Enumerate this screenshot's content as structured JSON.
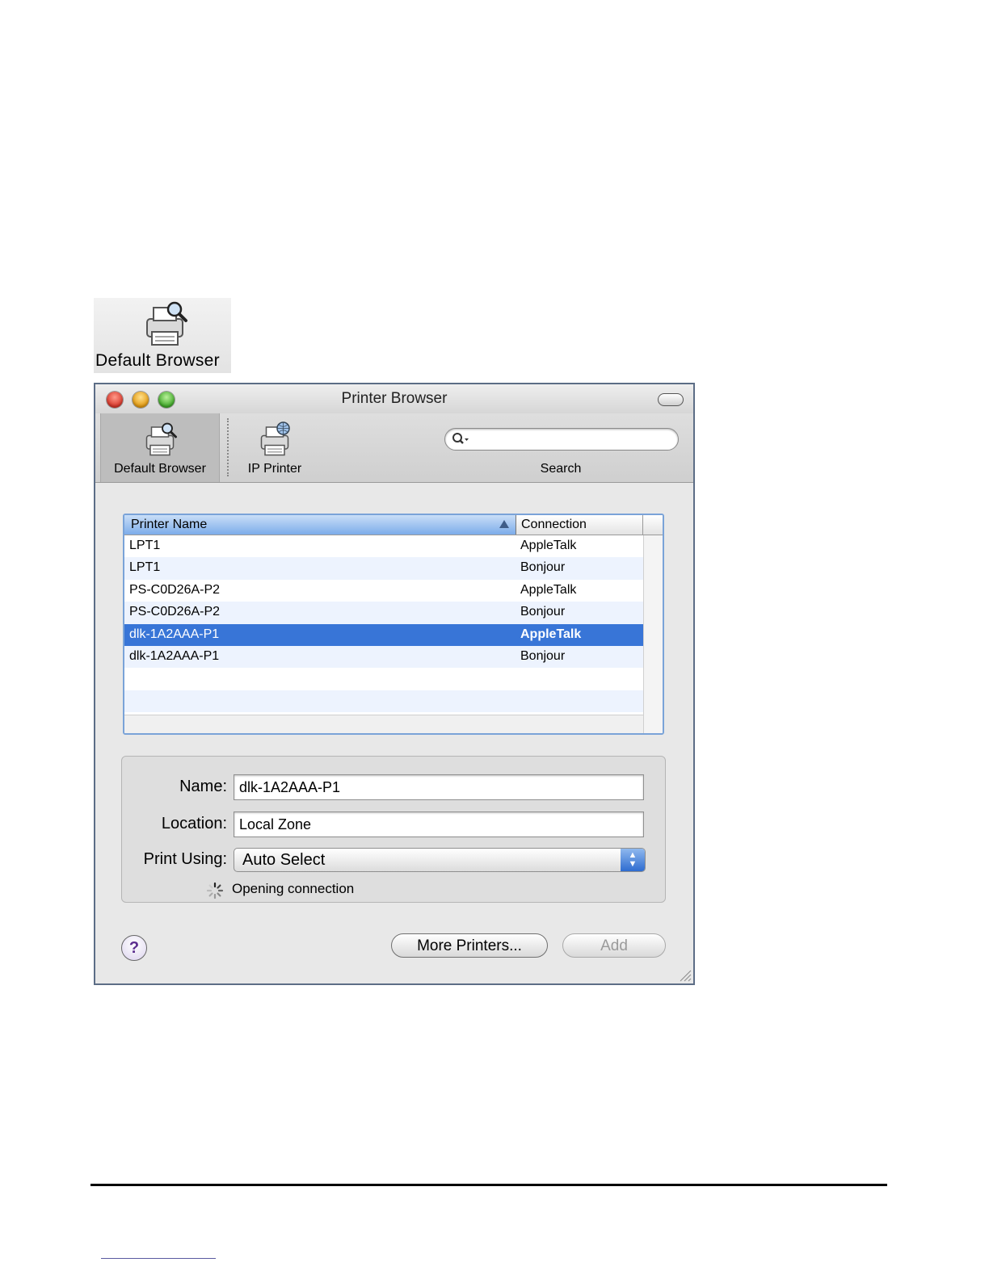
{
  "snippet": {
    "label": "Default Browser"
  },
  "window": {
    "title": "Printer Browser",
    "toolbar": {
      "default_browser_label": "Default Browser",
      "ip_printer_label": "IP Printer",
      "search_label": "Search",
      "search_value": ""
    },
    "table": {
      "columns": [
        "Printer Name",
        "Connection"
      ],
      "rows": [
        {
          "name": "LPT1",
          "connection": "AppleTalk"
        },
        {
          "name": "LPT1",
          "connection": "Bonjour"
        },
        {
          "name": "PS-C0D26A-P2",
          "connection": "AppleTalk"
        },
        {
          "name": "PS-C0D26A-P2",
          "connection": "Bonjour"
        },
        {
          "name": "dlk-1A2AAA-P1",
          "connection": "AppleTalk"
        },
        {
          "name": "dlk-1A2AAA-P1",
          "connection": "Bonjour"
        }
      ],
      "selected_row": 4
    },
    "details": {
      "name_label": "Name:",
      "name_value": "dlk-1A2AAA-P1",
      "location_label": "Location:",
      "location_value": "Local Zone",
      "print_using_label": "Print Using:",
      "print_using_value": "Auto Select",
      "status": "Opening connection"
    },
    "buttons": {
      "help": "?",
      "more_printers": "More Printers...",
      "add": "Add"
    }
  },
  "colors": {
    "selection": "#3875d7",
    "header_sorted": "#7cacea",
    "window_border": "#5c6d86"
  },
  "icons": [
    "printer-magnifier-icon",
    "printer-globe-icon",
    "search-icon",
    "spinner-icon",
    "resize-grip-icon"
  ]
}
